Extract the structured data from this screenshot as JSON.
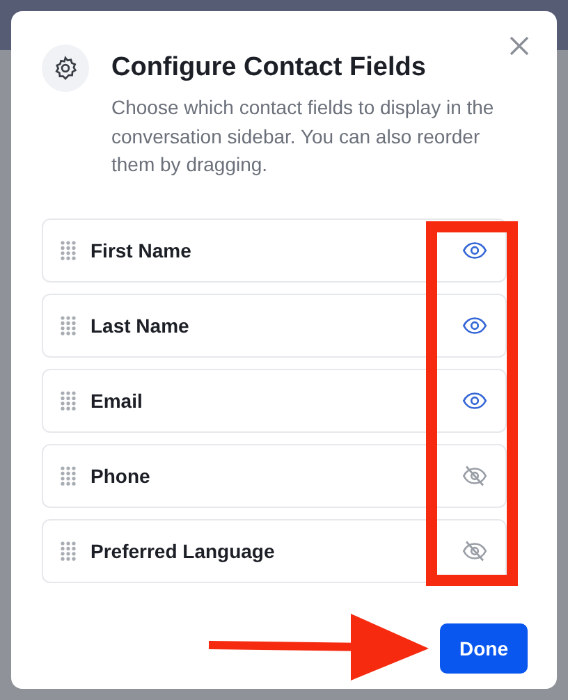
{
  "dialog": {
    "title": "Configure Contact Fields",
    "description": "Choose which contact fields to display in the conversation sidebar. You can also reorder them by dragging."
  },
  "fields": [
    {
      "label": "First Name",
      "visible": true
    },
    {
      "label": "Last Name",
      "visible": true
    },
    {
      "label": "Email",
      "visible": true
    },
    {
      "label": "Phone",
      "visible": false
    },
    {
      "label": "Preferred Language",
      "visible": false
    }
  ],
  "done_button": "Done"
}
